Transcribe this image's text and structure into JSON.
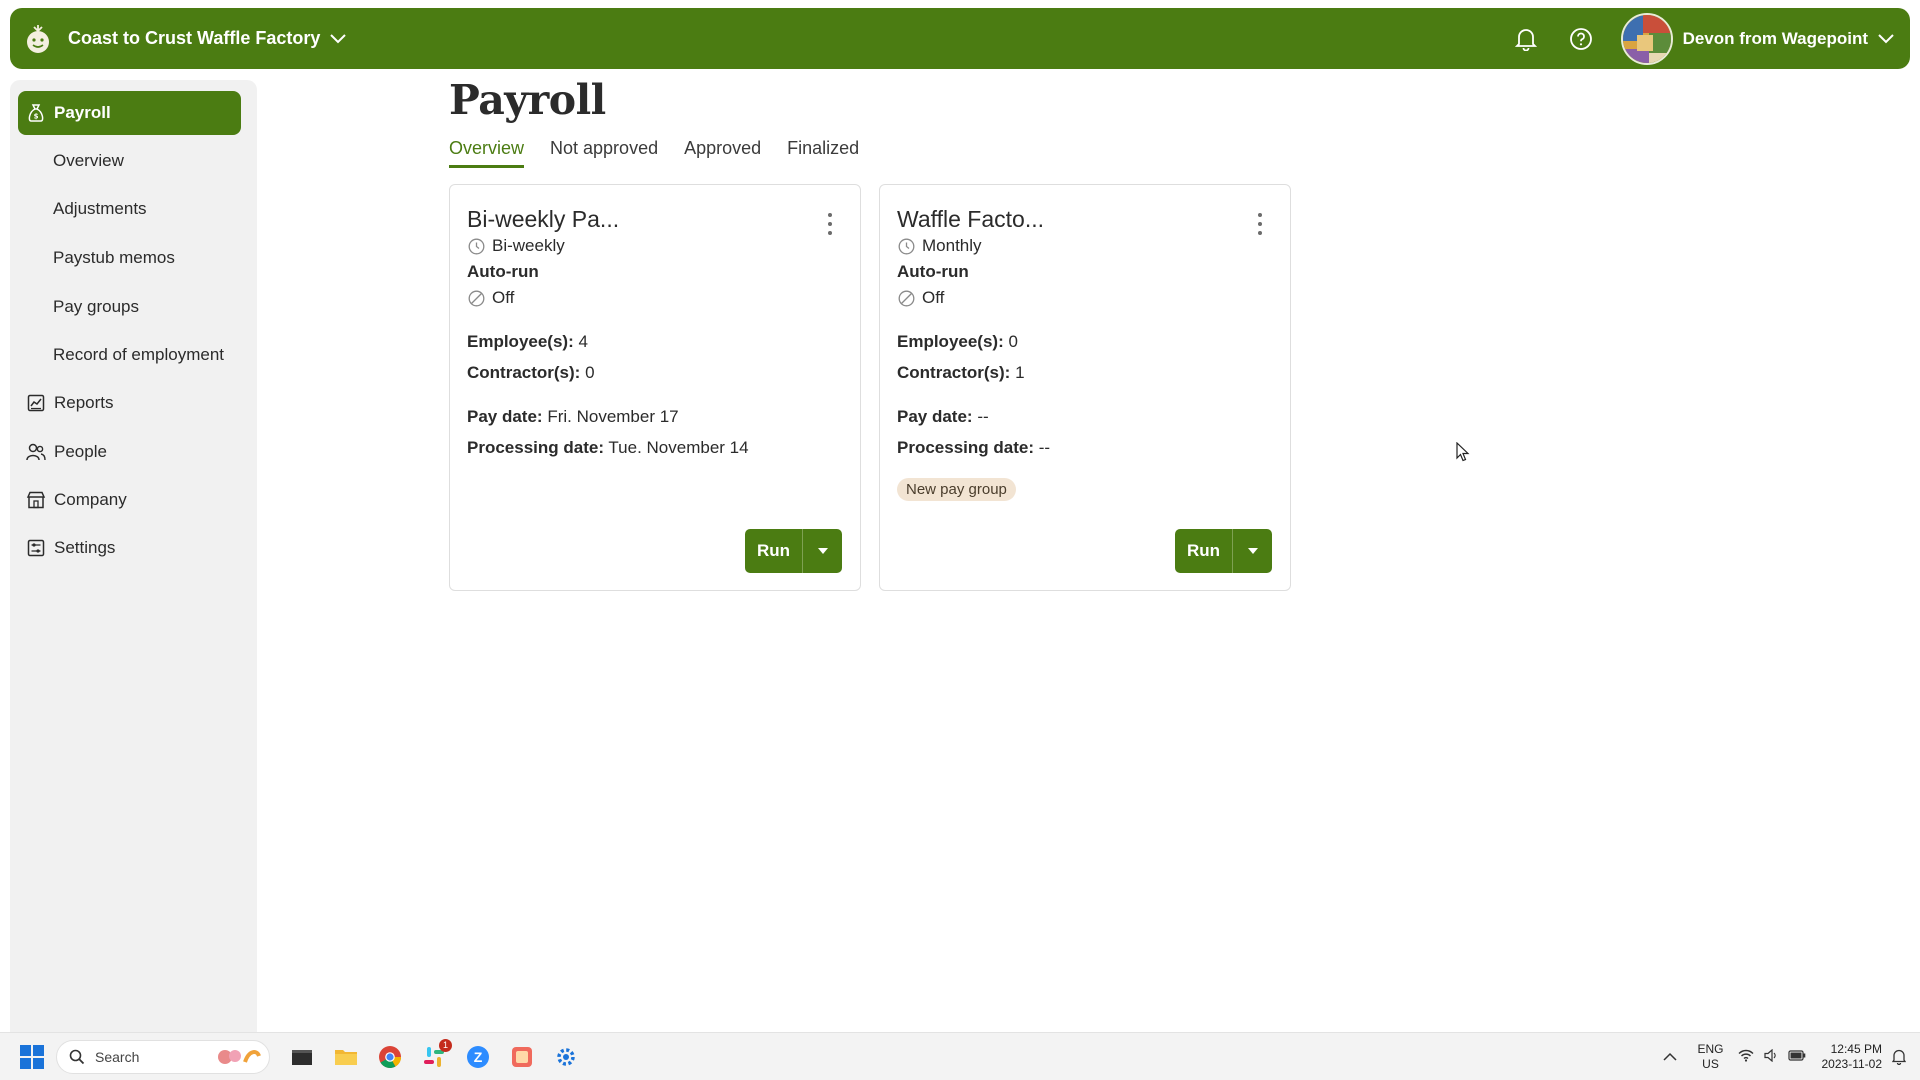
{
  "header": {
    "company_name": "Coast to Crust Waffle Factory",
    "user_name": "Devon from Wagepoint",
    "brand_color": "#4b7c12"
  },
  "sidebar": {
    "payroll": "Payroll",
    "sub_items": [
      "Overview",
      "Adjustments",
      "Paystub memos",
      "Pay groups",
      "Record of employment"
    ],
    "reports": "Reports",
    "people": "People",
    "company": "Company",
    "settings": "Settings"
  },
  "main": {
    "title": "Payroll",
    "tabs": [
      "Overview",
      "Not approved",
      "Approved",
      "Finalized"
    ],
    "active_tab": "Overview",
    "cards": [
      {
        "title": "Bi-weekly Pa...",
        "frequency": "Bi-weekly",
        "autorun_label": "Auto-run",
        "autorun_value": "Off",
        "employees_label": "Employee(s):",
        "employees_value": " 4",
        "contractors_label": "Contractor(s):",
        "contractors_value": " 0",
        "pay_date_label": "Pay date:",
        "pay_date_value": " Fri. November 17",
        "processing_label": "Processing date:",
        "processing_value": " Tue. November 14",
        "badge": "",
        "run_label": "Run"
      },
      {
        "title": "Waffle Facto...",
        "frequency": "Monthly",
        "autorun_label": "Auto-run",
        "autorun_value": "Off",
        "employees_label": "Employee(s):",
        "employees_value": " 0",
        "contractors_label": "Contractor(s):",
        "contractors_value": " 1",
        "pay_date_label": "Pay date:",
        "pay_date_value": " --",
        "processing_label": "Processing date:",
        "processing_value": " --",
        "badge": "New pay group",
        "run_label": "Run"
      }
    ]
  },
  "taskbar": {
    "search_placeholder": "Search",
    "lang_top": "ENG",
    "lang_bottom": "US",
    "time": "12:45 PM",
    "date": "2023-11-02",
    "slack_badge": "1"
  }
}
